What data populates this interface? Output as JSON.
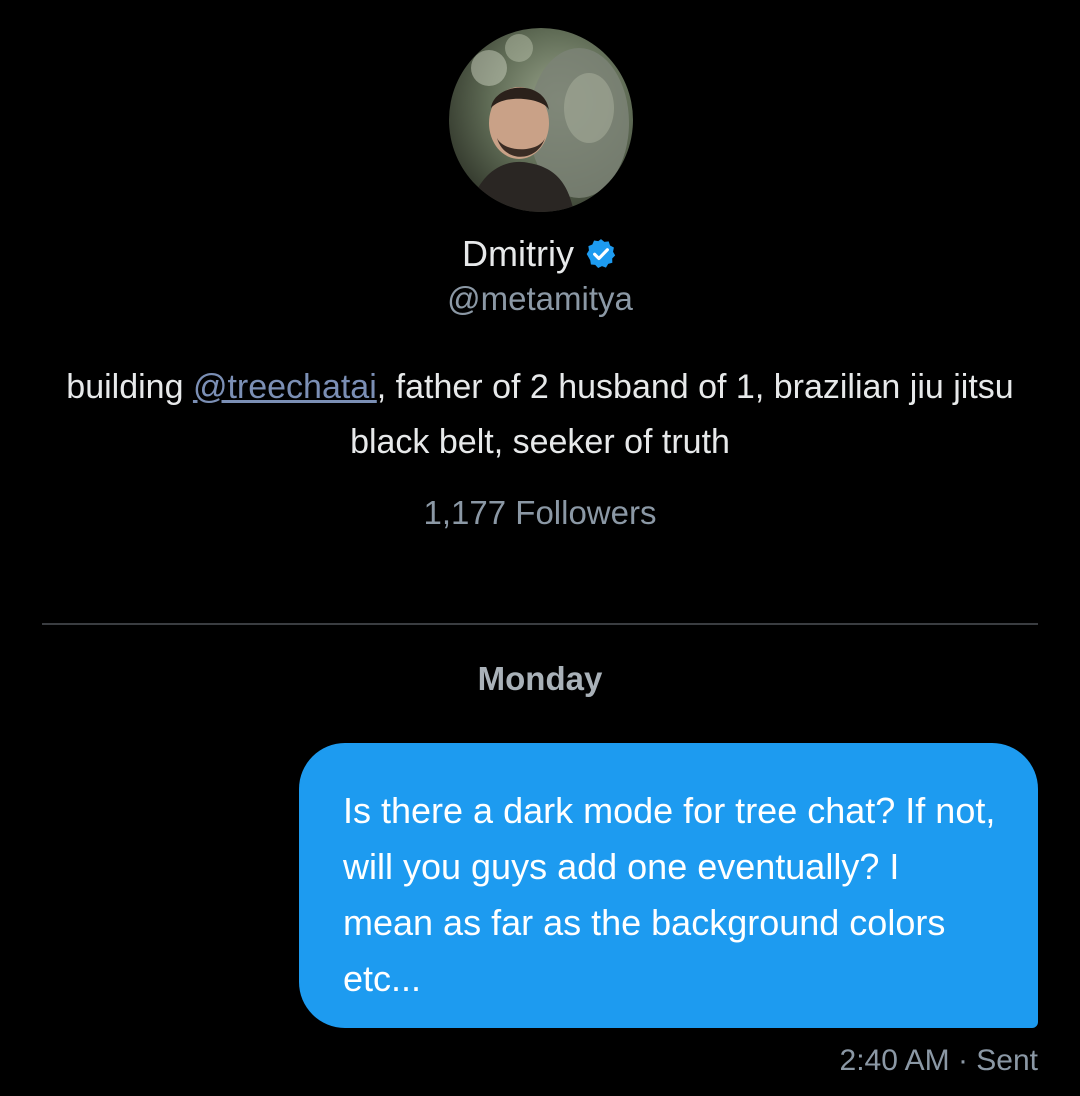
{
  "profile": {
    "name": "Dmitriy",
    "handle": "@metamitya",
    "bio_prefix": "building ",
    "bio_mention": "@treechatai",
    "bio_suffix": ", father of 2 husband of 1, brazilian jiu jitsu black belt, seeker of truth",
    "followers_count": "1,177",
    "followers_label": "Followers",
    "verified_icon": "verified-badge-icon",
    "verified_color": "#1d9bf0"
  },
  "conversation": {
    "day_label": "Monday",
    "messages": [
      {
        "text": "Is there a dark mode for tree chat?  If not, will you guys add one eventually?  I mean as far as the background colors etc...",
        "time": "2:40 AM",
        "separator": "·",
        "status": "Sent",
        "bubble_color": "#1d9bf0"
      }
    ]
  },
  "colors": {
    "background": "#000000",
    "primary_text": "#e7e9ea",
    "secondary_text": "#8b98a5",
    "accent": "#1d9bf0"
  }
}
